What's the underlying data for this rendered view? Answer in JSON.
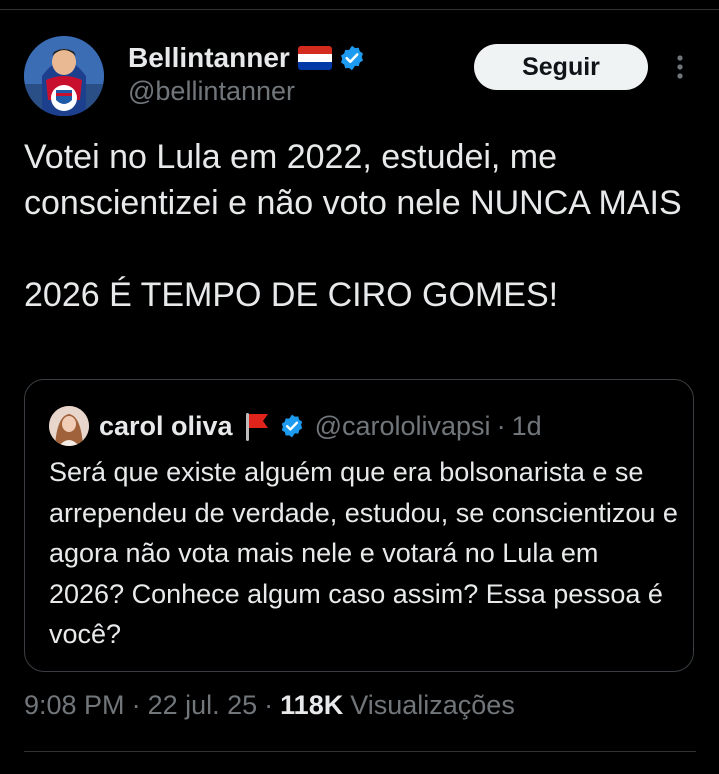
{
  "author": {
    "display_name": "Bellintanner",
    "handle": "@bellintanner",
    "flag_icon": "paraguay-flag-icon",
    "verified_icon": "verified-badge-icon"
  },
  "follow_button": {
    "label": "Seguir"
  },
  "tweet": {
    "text": "Votei no Lula em 2022, estudei, me conscientizei e não voto nele NUNCA MAIS\n\n2026 É TEMPO DE CIRO GOMES!"
  },
  "quote": {
    "display_name": "carol oliva",
    "flag_icon": "red-flag-icon",
    "verified_icon": "verified-badge-icon",
    "handle": "@carololivapsi",
    "separator": "·",
    "time": "1d",
    "text": "Será que existe alguém que era bolsonarista e se arrependeu de verdade, estudou, se conscientizou e agora não vota mais nele e votará no Lula em 2026? Conhece algum caso assim? Essa pessoa é você?"
  },
  "meta": {
    "time": "9:08 PM",
    "sep1": "·",
    "date": "22 jul. 25",
    "sep2": "·",
    "views_count": "118K",
    "views_label": "Visualizações"
  },
  "colors": {
    "background": "#000000",
    "text_primary": "#e7e9ea",
    "text_secondary": "#71767b",
    "verified_blue": "#1d9bf0",
    "button_bg": "#eff3f4"
  }
}
